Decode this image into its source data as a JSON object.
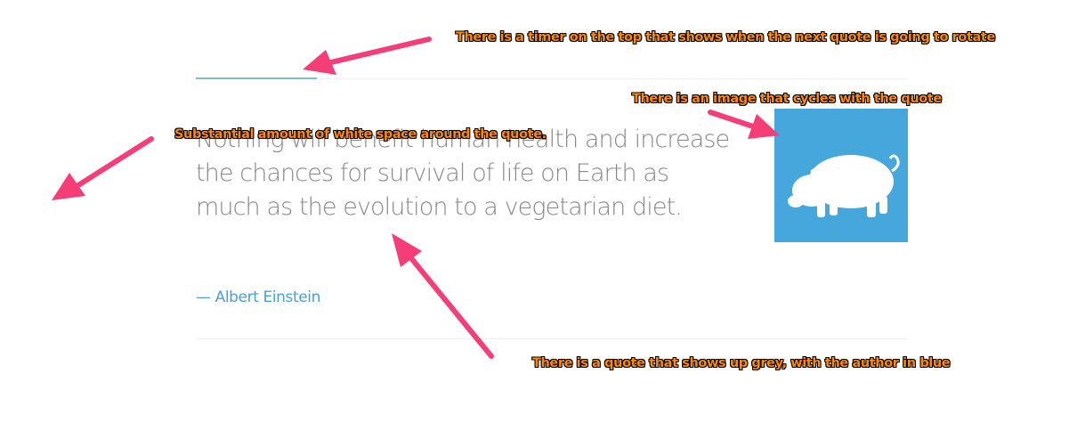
{
  "timer": {
    "progress": 0.17,
    "color": "#7fbfc4"
  },
  "quote": {
    "text": "Nothing will benefit human health and increase the chances for survival of life on Earth as much as the evolution to a vegetarian diet.",
    "author": "— Albert Einstein",
    "text_color": "#888888",
    "author_color": "#4a9fd6"
  },
  "image": {
    "icon": "pig-icon",
    "background": "#46a7dd"
  },
  "annotations": {
    "timer_note": "There is a timer on the top that shows when the next quote is going to rotate",
    "image_note": "There is an image that cycles with the quote",
    "space_note": "Substantial amount of white space around the quote.",
    "quote_note": "There is a quote that shows up grey, with the author in blue",
    "text_color": "#ff8a00",
    "arrow_color": "#f53d78"
  }
}
